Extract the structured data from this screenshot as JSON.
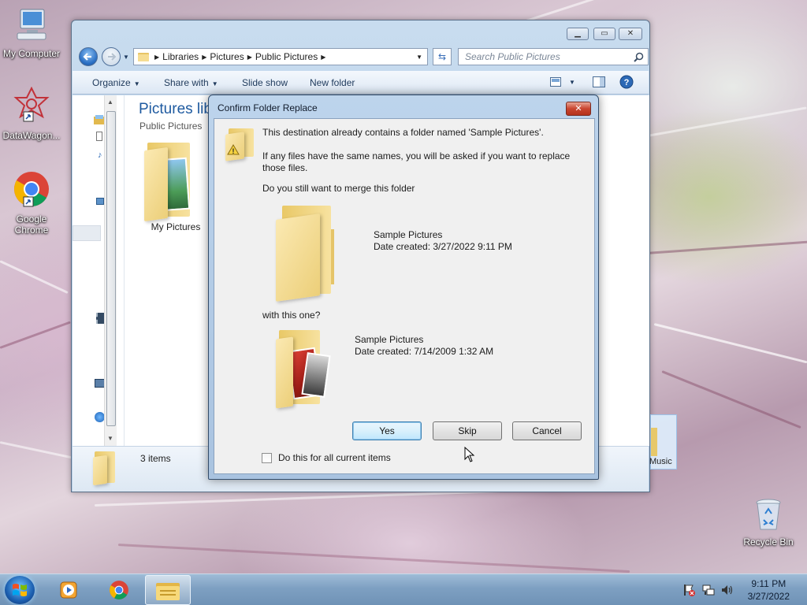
{
  "desktop": {
    "icons": [
      {
        "label": "My Computer"
      },
      {
        "label": "DataWagon..."
      },
      {
        "label": "Google Chrome"
      },
      {
        "label": "Recycle Bin"
      }
    ]
  },
  "explorer": {
    "address": {
      "crumbs": [
        "Libraries",
        "Pictures",
        "Public Pictures"
      ]
    },
    "search_placeholder": "Search Public Pictures",
    "toolbar": {
      "organize": "Organize",
      "share_with": "Share with",
      "slide_show": "Slide show",
      "new_folder": "New folder"
    },
    "library_title": "Pictures lib",
    "library_subtitle": "Public Pictures",
    "folders": [
      {
        "label": "My Pictures"
      }
    ],
    "partial_right_label": "Music",
    "status": {
      "items_count": "3 items"
    }
  },
  "dialog": {
    "title": "Confirm Folder Replace",
    "close_glyph": "✕",
    "message1": "This destination already contains a folder named 'Sample Pictures'.",
    "message2": "If any files have the same names, you will be asked if you want to replace those files.",
    "message3": "Do you still want to merge this folder",
    "dest_folder": {
      "name": "Sample Pictures",
      "date": "Date created: 3/27/2022 9:11 PM"
    },
    "with_text": "with this one?",
    "src_folder": {
      "name": "Sample Pictures",
      "date": "Date created: 7/14/2009 1:32 AM"
    },
    "buttons": {
      "yes": "Yes",
      "skip": "Skip",
      "cancel": "Cancel"
    },
    "checkbox_label": "Do this for all current items"
  },
  "taskbar": {
    "time": "9:11 PM",
    "date": "3/27/2022"
  },
  "colors": {
    "accent": "#3c7fb1",
    "title_bar": "#bdd4ec",
    "taskbar": "#7ea0c2"
  }
}
